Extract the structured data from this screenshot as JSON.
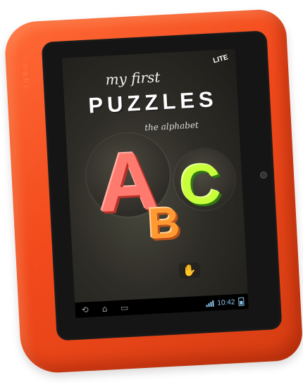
{
  "case": {
    "brand_text": "nabi",
    "color": "#f24a1c"
  },
  "app": {
    "badge": "LITE",
    "title_top": "my first",
    "title_main": "PUZZLES",
    "title_sub": "the alphabet",
    "letters": {
      "a": "A",
      "b": "B",
      "c": "C"
    },
    "letter_colors": {
      "a": "#ff7a6e",
      "b": "#ff9a33",
      "c": "#c8ff3a"
    },
    "hand_icon": "hand-icon"
  },
  "nav_bar": {
    "back_icon": "back-icon",
    "home_icon": "home-icon",
    "recents_icon": "recents-icon",
    "time": "10:42",
    "signal_icon": "signal-bars-icon",
    "battery_icon": "battery-icon"
  }
}
